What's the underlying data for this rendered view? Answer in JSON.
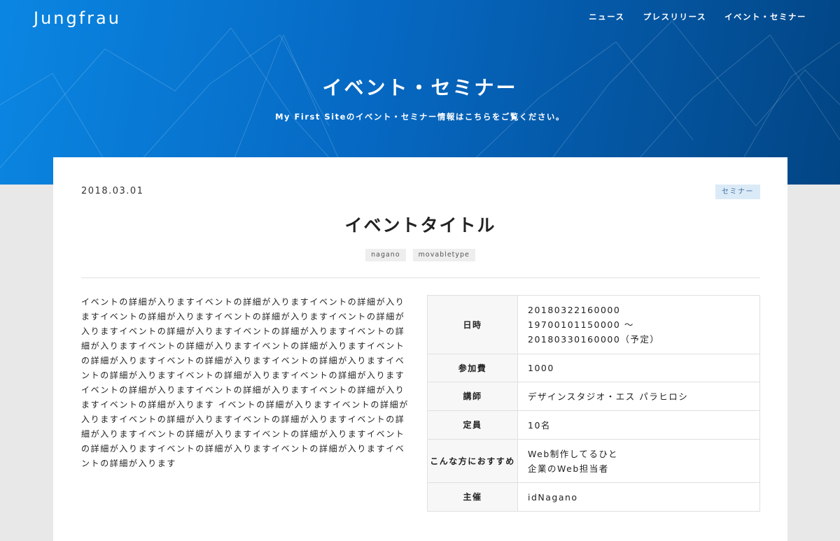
{
  "header": {
    "logo": "Jungfrau",
    "nav": [
      "ニュース",
      "プレスリリース",
      "イベント・セミナー"
    ],
    "title": "イベント・セミナー",
    "subtitle": "My First Siteのイベント・セミナー情報はこちらをご覧ください。"
  },
  "post": {
    "date": "2018.03.01",
    "category": "セミナー",
    "title": "イベントタイトル",
    "tags": [
      "nagano",
      "movabletype"
    ],
    "body": "イベントの詳細が入りますイベントの詳細が入りますイベントの詳細が入りますイベントの詳細が入りますイベントの詳細が入りますイベントの詳細が入りますイベントの詳細が入りますイベントの詳細が入りますイベントの詳細が入りますイベントの詳細が入りますイベントの詳細が入りますイベントの詳細が入りますイベントの詳細が入りますイベントの詳細が入りますイベントの詳細が入りますイベントの詳細が入りますイベントの詳細が入りますイベントの詳細が入りますイベントの詳細が入りますイベントの詳細が入りますイベントの詳細が入ります イベントの詳細が入りますイベントの詳細が入りますイベントの詳細が入りますイベントの詳細が入りますイベントの詳細が入りますイベントの詳細が入りますイベントの詳細が入りますイベントの詳細が入りますイベントの詳細が入りますイベントの詳細が入りますイベントの詳細が入ります"
  },
  "details": {
    "datetime_label": "日時",
    "datetime_lines": [
      "20180322160000",
      "19700101150000 ～",
      "20180330160000（予定）"
    ],
    "fee_label": "参加費",
    "fee": "1000",
    "instructor_label": "講師",
    "instructor": "デザインスタジオ・エス パラヒロシ",
    "capacity_label": "定員",
    "capacity": "10名",
    "audience_label": "こんな方におすすめ",
    "audience_lines": [
      "Web制作してるひと",
      "企業のWeb担当者"
    ],
    "organizer_label": "主催",
    "organizer": "idNagano"
  }
}
